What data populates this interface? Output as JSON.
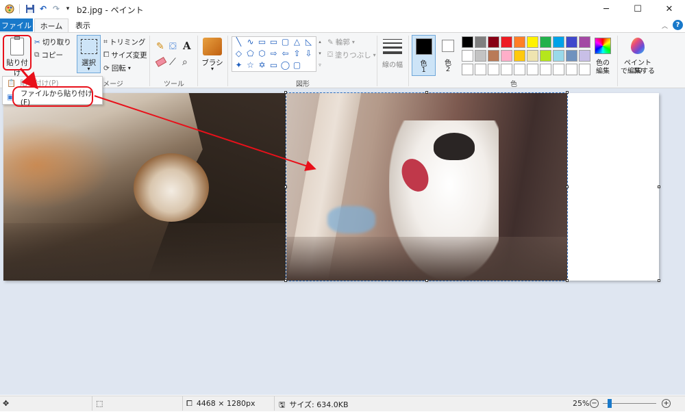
{
  "window": {
    "title": "b2.jpg - ペイント",
    "minimize": "─",
    "maximize": "☐",
    "close": "✕"
  },
  "tabs": {
    "file": "ファイル",
    "home": "ホーム",
    "view": "表示"
  },
  "clipboard": {
    "paste_label": "貼り付け",
    "cut_label": "切り取り",
    "copy_label": "コピー",
    "paste_menu_item1": "貼り付け(P)",
    "paste_menu_item2": "ファイルから貼り付け(F)"
  },
  "image": {
    "group_label": "イメージ",
    "select_label": "選択",
    "crop_label": "トリミング",
    "resize_label": "サイズ変更",
    "rotate_label": "回転"
  },
  "tools": {
    "group_label": "ツール",
    "text_glyph": "A"
  },
  "brushes": {
    "label": "ブラシ"
  },
  "shapes": {
    "group_label": "図形",
    "outline_label": "輪郭",
    "fill_label": "塗りつぶし",
    "glyphs": [
      "╲",
      "∿",
      "▭",
      "▭",
      "▢",
      "△",
      "◺",
      "◇",
      "⬠",
      "⬡",
      "⇨",
      "⇦",
      "⇧",
      "⇩",
      "✦",
      "☆",
      "✡",
      "▭",
      "◯",
      "▢"
    ]
  },
  "size": {
    "label": "線の幅"
  },
  "colors": {
    "group_label": "色",
    "color1_label": "色\n1",
    "color1_a": "色",
    "color1_b": "1",
    "color2_a": "色",
    "color2_b": "2",
    "edit_label_a": "色の",
    "edit_label_b": "編集",
    "color1": "#000000",
    "color2": "#ffffff",
    "palette_row1": [
      "#000000",
      "#7f7f7f",
      "#880015",
      "#ed1c24",
      "#ff7f27",
      "#fff200",
      "#22b14c",
      "#00a2e8",
      "#3f48cc",
      "#a349a4"
    ],
    "palette_row2": [
      "#ffffff",
      "#c3c3c3",
      "#b97a57",
      "#ffaec9",
      "#ffc90e",
      "#efe4b0",
      "#b5e61d",
      "#99d9ea",
      "#7092be",
      "#c8bfe7"
    ]
  },
  "paint3d": {
    "label_a": "ペイント 3D",
    "label_b": "で編集する"
  },
  "status": {
    "dimensions": "4468 × 1280px",
    "file_size": "サイズ: 634.0KB",
    "zoom": "25%"
  },
  "accent": "#1979ca",
  "annotation_color": "#e8101a"
}
